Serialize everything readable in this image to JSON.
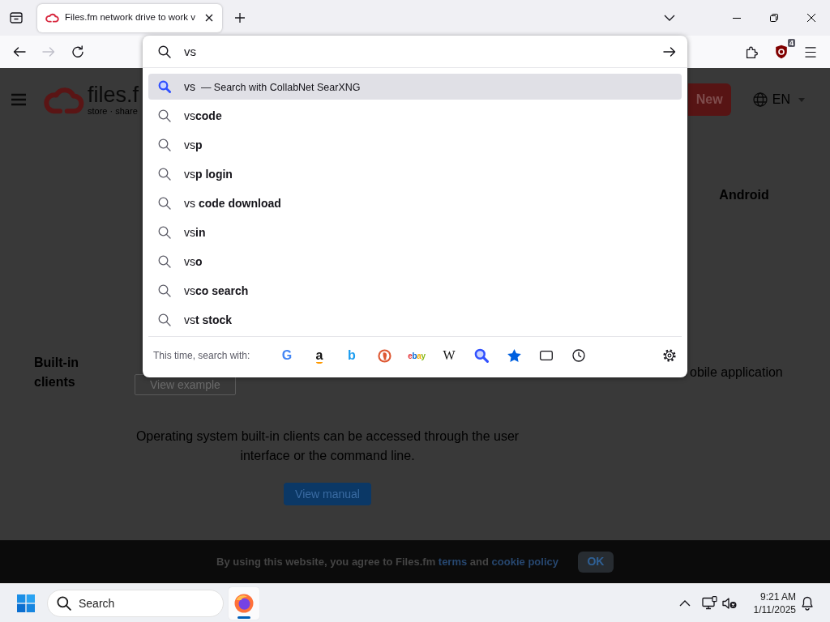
{
  "tab_strip": {
    "tabs": [
      {
        "title": "Files.fm network drive to work v",
        "selected": true
      }
    ]
  },
  "toolbar": {
    "nav_buttons": [
      {
        "kind": "back",
        "disabled": false
      },
      {
        "kind": "forward",
        "disabled": true
      },
      {
        "kind": "reload",
        "disabled": false
      }
    ],
    "extension_badge": "4"
  },
  "address_bar": {
    "value": "vs"
  },
  "suggestions": [
    {
      "kind": "engine",
      "text": "vs",
      "action": "— Search with CollabNet SearXNG",
      "selected": true
    },
    {
      "kind": "suggestion",
      "text": "vs**code**",
      "selected": false
    },
    {
      "kind": "suggestion",
      "text": "vs**p**",
      "selected": false
    },
    {
      "kind": "suggestion",
      "text": "vs**p login**",
      "selected": false
    },
    {
      "kind": "suggestion",
      "text": "vs **code download**",
      "selected": false
    },
    {
      "kind": "suggestion",
      "text": "vs**in**",
      "selected": false
    },
    {
      "kind": "suggestion",
      "text": "vs**o**",
      "selected": false
    },
    {
      "kind": "suggestion",
      "text": "vs**co search**",
      "selected": false
    },
    {
      "kind": "suggestion",
      "text": "vs**t stock**",
      "selected": false
    }
  ],
  "search_footer": {
    "label": "This time, search with:",
    "engines": [
      {
        "kind": "google",
        "mark": "G"
      },
      {
        "kind": "amazon",
        "mark": "a"
      },
      {
        "kind": "bing",
        "mark": "b"
      },
      {
        "kind": "duckduckgo"
      },
      {
        "kind": "ebay",
        "mark": "ebay"
      },
      {
        "kind": "wikipedia",
        "mark": "W"
      },
      {
        "kind": "searxng"
      },
      {
        "kind": "bookmarks"
      },
      {
        "kind": "tabs"
      },
      {
        "kind": "history"
      }
    ]
  },
  "page": {
    "logo": {
      "name": "files.f",
      "tagline": "store · share"
    },
    "new_button": "New",
    "language": "EN",
    "android_heading": "Android",
    "row_heading": "Built-in clients",
    "example_button": "View example",
    "mobile_text": "obile application",
    "description": "Operating system built-in clients can be accessed through the user interface or the command line.",
    "manual_button": "View manual"
  },
  "cookie_bar": {
    "parts": [
      {
        "kind": "text",
        "text": "By using this website, you agree to Files.fm"
      },
      {
        "kind": "link",
        "text": "terms"
      },
      {
        "kind": "text",
        "text": "and"
      },
      {
        "kind": "link",
        "text": "cookie policy"
      }
    ],
    "button": "OK"
  },
  "taskbar": {
    "search_placeholder": "Search",
    "apps": [
      {
        "active": true
      }
    ],
    "time": "9:21 AM",
    "date": "1/11/2025"
  }
}
